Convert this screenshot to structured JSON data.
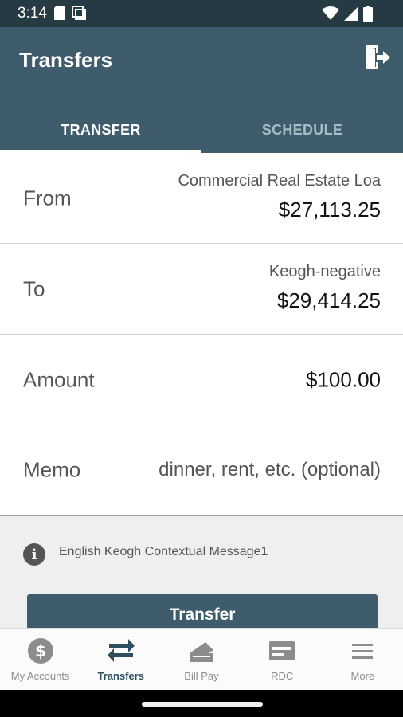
{
  "status_bar": {
    "time": "3:14"
  },
  "header": {
    "title": "Transfers",
    "logout_icon": "logout-door-icon"
  },
  "tabs": [
    {
      "label": "TRANSFER",
      "active": true
    },
    {
      "label": "SCHEDULE",
      "active": false
    }
  ],
  "form": {
    "from": {
      "label": "From",
      "account_name": "Commercial Real Estate Loa",
      "balance": "$27,113.25"
    },
    "to": {
      "label": "To",
      "account_name": "Keogh-negative",
      "balance": "$29,414.25"
    },
    "amount": {
      "label": "Amount",
      "value": "$100.00"
    },
    "memo": {
      "label": "Memo",
      "placeholder": "dinner, rent, etc. (optional)"
    }
  },
  "info": {
    "icon": "info-icon",
    "message": "English Keogh Contextual Message1"
  },
  "actions": {
    "transfer_label": "Transfer"
  },
  "bottom_nav": [
    {
      "label": "My Accounts",
      "icon": "dollar-circle-icon",
      "active": false
    },
    {
      "label": "Transfers",
      "icon": "transfer-arrows-icon",
      "active": true
    },
    {
      "label": "Bill Pay",
      "icon": "bill-pay-icon",
      "active": false
    },
    {
      "label": "RDC",
      "icon": "check-deposit-icon",
      "active": false
    },
    {
      "label": "More",
      "icon": "menu-icon",
      "active": false
    }
  ],
  "colors": {
    "status_bar": "#263a44",
    "primary": "#3e5c6b",
    "nav_active": "#2e4e5e",
    "nav_inactive": "#8c8c8c"
  }
}
